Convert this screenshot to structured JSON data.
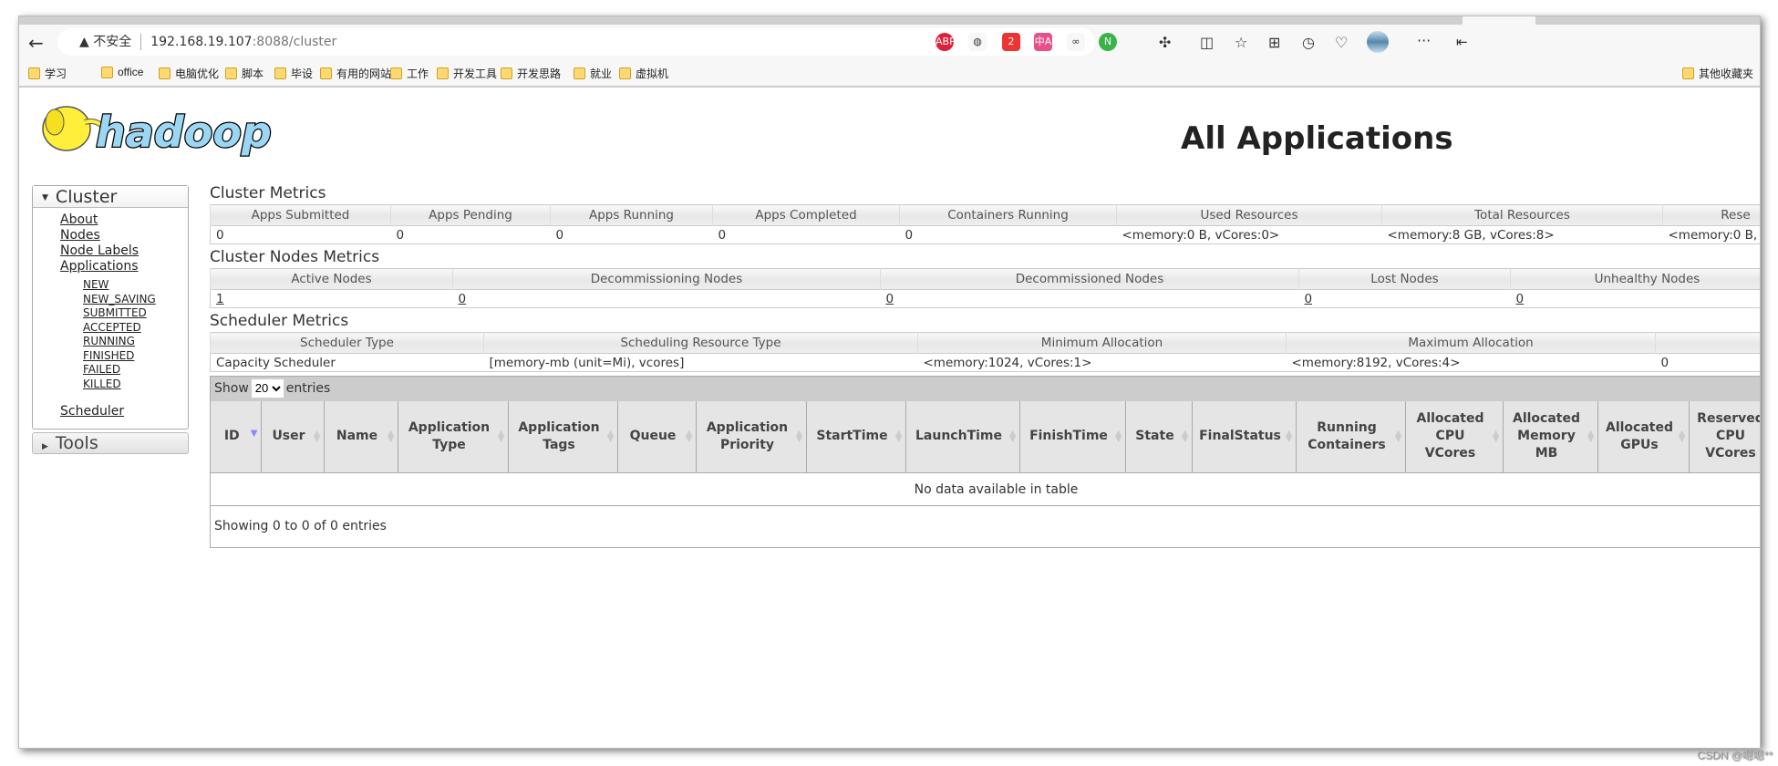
{
  "browser": {
    "security": "不安全",
    "url_host": "192.168.19.107",
    "url_rest": ":8088/cluster",
    "bookmarks": [
      "学习",
      "office",
      "电脑优化",
      "脚本",
      "毕设",
      "有用的网站",
      "工作",
      "开发工具",
      "开发思路",
      "就业",
      "虚拟机"
    ],
    "other_bookmarks": "其他收藏夹",
    "extensions": [
      {
        "name": "abp",
        "label": "ABP",
        "color": "#e0203a"
      },
      {
        "name": "globe",
        "label": "◍",
        "color": "#f7f7f7"
      },
      {
        "name": "badge",
        "label": "2",
        "color": "#e33"
      },
      {
        "name": "translate",
        "label": "中A",
        "color": "#e8508a"
      },
      {
        "name": "link",
        "label": "∞",
        "color": "#f7f7f7"
      },
      {
        "name": "n",
        "label": "N",
        "color": "#3cb34a"
      }
    ]
  },
  "logo_text": "hadoop",
  "page_title": "All Applications",
  "sidebar": {
    "cluster": "Cluster",
    "links": [
      "About",
      "Nodes",
      "Node Labels",
      "Applications"
    ],
    "app_states": [
      "NEW",
      "NEW_SAVING",
      "SUBMITTED",
      "ACCEPTED",
      "RUNNING",
      "FINISHED",
      "FAILED",
      "KILLED"
    ],
    "scheduler": "Scheduler",
    "tools": "Tools"
  },
  "cluster_metrics": {
    "title": "Cluster Metrics",
    "headers": [
      "Apps Submitted",
      "Apps Pending",
      "Apps Running",
      "Apps Completed",
      "Containers Running",
      "Used Resources",
      "Total Resources",
      "Rese"
    ],
    "values": [
      "0",
      "0",
      "0",
      "0",
      "0",
      "<memory:0 B, vCores:0>",
      "<memory:8 GB, vCores:8>",
      "<memory:0 B,"
    ]
  },
  "nodes_metrics": {
    "title": "Cluster Nodes Metrics",
    "headers": [
      "Active Nodes",
      "Decommissioning Nodes",
      "Decommissioned Nodes",
      "Lost Nodes",
      "Unhealthy Nodes"
    ],
    "values": [
      "1",
      "0",
      "0",
      "0",
      "0"
    ]
  },
  "scheduler_metrics": {
    "title": "Scheduler Metrics",
    "headers": [
      "Scheduler Type",
      "Scheduling Resource Type",
      "Minimum Allocation",
      "Maximum Allocation",
      ""
    ],
    "values": [
      "Capacity Scheduler",
      "[memory-mb (unit=Mi), vcores]",
      "<memory:1024, vCores:1>",
      "<memory:8192, vCores:4>",
      "0"
    ]
  },
  "apps_table": {
    "show": "Show",
    "entries_label": "entries",
    "page_size": "20",
    "columns": [
      "ID",
      "User",
      "Name",
      "Application Type",
      "Application Tags",
      "Queue",
      "Application Priority",
      "StartTime",
      "LaunchTime",
      "FinishTime",
      "State",
      "FinalStatus",
      "Running Containers",
      "Allocated CPU VCores",
      "Allocated Memory MB",
      "Allocated GPUs",
      "Reserved CPU VCores"
    ],
    "empty": "No data available in table",
    "info": "Showing 0 to 0 of 0 entries"
  },
  "watermark": "CSDN @嗯嗯**"
}
